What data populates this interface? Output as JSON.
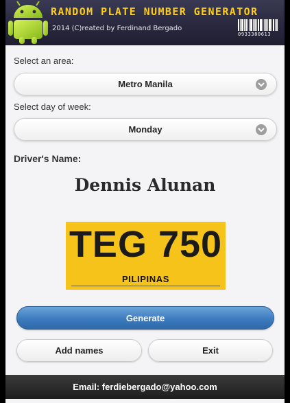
{
  "header": {
    "title": "Random Plate Number Generator",
    "subtitle": "2014 (C)reated by Ferdinand Bergado",
    "barcode_digits": "0933380613"
  },
  "area": {
    "label": "Select an area:",
    "value": "Metro Manila"
  },
  "day": {
    "label": "Select day of week:",
    "value": "Monday"
  },
  "driver": {
    "label": "Driver's Name:",
    "name": "Dennis Alunan"
  },
  "plate": {
    "number": "TEG 750",
    "country": "PILIPINAS",
    "color": "#f5c319"
  },
  "buttons": {
    "generate": "Generate",
    "add_names": "Add names",
    "exit": "Exit"
  },
  "footer": {
    "email": "Email: ferdiebergado@yahoo.com"
  },
  "colors": {
    "header_bg": "#2c2b42",
    "title": "#ffcc1a",
    "primary": "#3d7bbf"
  },
  "icons": [
    "android-robot-icon",
    "barcode-icon",
    "chevron-down-icon"
  ]
}
